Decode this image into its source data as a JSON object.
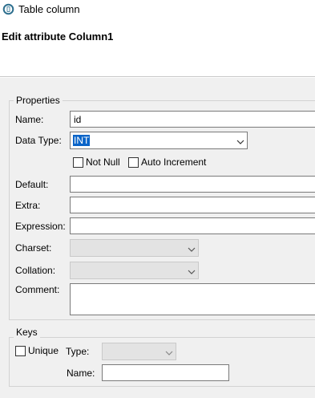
{
  "window": {
    "title": "Table column",
    "icon": "column-icon"
  },
  "dialog": {
    "heading": "Edit attribute Column1"
  },
  "properties": {
    "legend": "Properties",
    "name": {
      "label": "Name:",
      "value": "id"
    },
    "data_type": {
      "label": "Data Type:",
      "value": "INT"
    },
    "not_null": {
      "label": "Not Null",
      "checked": false
    },
    "auto_increment": {
      "label": "Auto Increment",
      "checked": false
    },
    "default": {
      "label": "Default:",
      "value": ""
    },
    "extra": {
      "label": "Extra:",
      "value": ""
    },
    "expression": {
      "label": "Expression:",
      "value": ""
    },
    "charset": {
      "label": "Charset:",
      "value": ""
    },
    "collation": {
      "label": "Collation:",
      "value": ""
    },
    "comment": {
      "label": "Comment:",
      "value": ""
    }
  },
  "keys": {
    "legend": "Keys",
    "unique": {
      "label": "Unique",
      "checked": false
    },
    "type": {
      "label": "Type:",
      "value": ""
    },
    "name": {
      "label": "Name:",
      "value": ""
    }
  },
  "colors": {
    "selection": "#0a64c8",
    "panel_bg": "#f0f0f0"
  }
}
